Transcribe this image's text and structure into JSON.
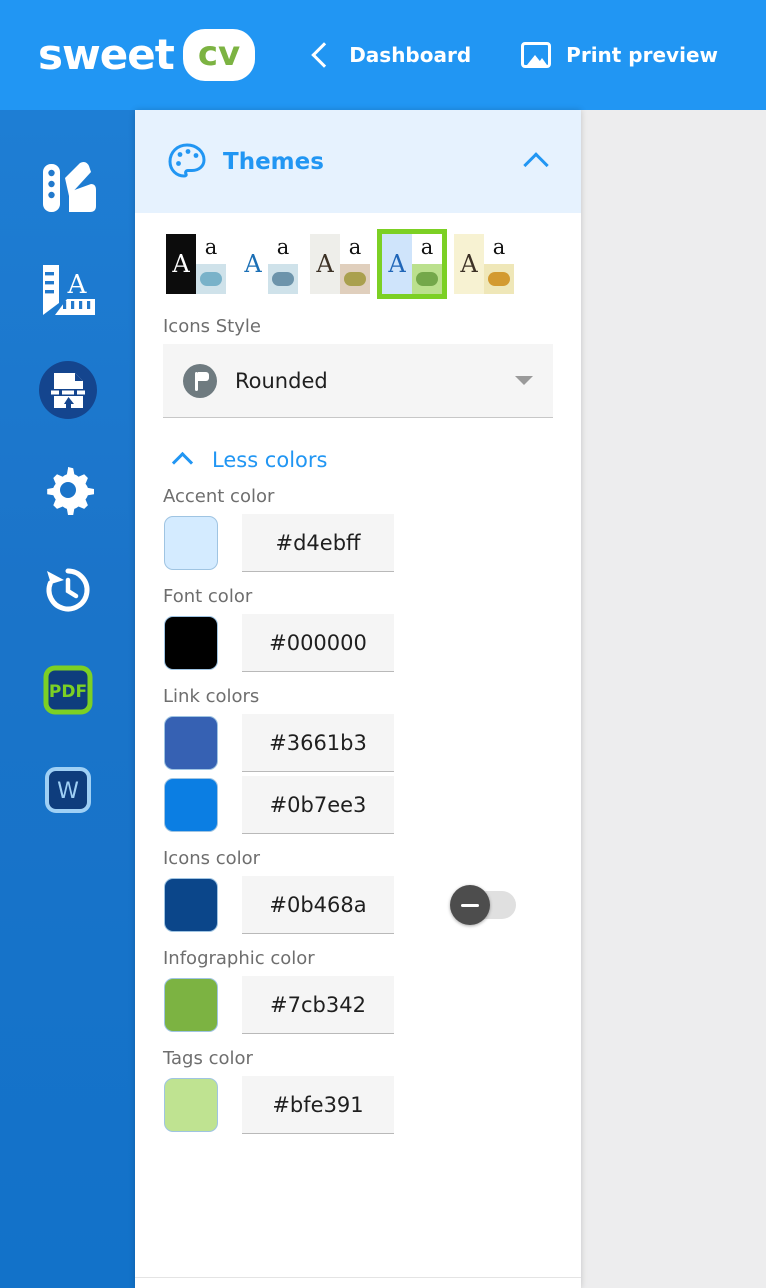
{
  "header": {
    "logo_word": "sweet",
    "logo_badge": "cv",
    "back_label": "Dashboard",
    "print_label": "Print preview",
    "bar_color": "#2196f3",
    "badge_text_color": "#7cb342"
  },
  "sidebar": {
    "items": [
      {
        "name": "themes-palette-icon",
        "label": "Themes"
      },
      {
        "name": "typography-icon",
        "label": "Typography"
      },
      {
        "name": "import-export-icon",
        "label": "Import / Export"
      },
      {
        "name": "settings-gear-icon",
        "label": "Settings"
      },
      {
        "name": "history-icon",
        "label": "History"
      },
      {
        "name": "pdf-icon",
        "label": "PDF"
      },
      {
        "name": "word-icon",
        "label": "W"
      }
    ]
  },
  "panel": {
    "title": "Themes",
    "collapse_icon": "chevron-up-icon",
    "themes": [
      {
        "name": "theme-dark",
        "selected": false,
        "letter_a_bg": "#0c0c0c",
        "letter_a_color": "#ffffff",
        "small_a_bg": "#ffffff",
        "small_a_color": "#111111",
        "dot_bg": "#cfe2ea",
        "dot_color": "#79b2c9"
      },
      {
        "name": "theme-white-blue",
        "selected": false,
        "letter_a_bg": "#ffffff",
        "letter_a_color": "#1b6fb5",
        "small_a_bg": "#ffffff",
        "small_a_color": "#111111",
        "dot_bg": "#cfe2ea",
        "dot_color": "#6d94ab"
      },
      {
        "name": "theme-beige",
        "selected": false,
        "letter_a_bg": "#eeeeea",
        "letter_a_color": "#3d3226",
        "small_a_bg": "#ffffff",
        "small_a_color": "#111111",
        "dot_bg": "#e0cfbd",
        "dot_color": "#aaa04e"
      },
      {
        "name": "theme-blue-green",
        "selected": true,
        "letter_a_bg": "#cfe4fb",
        "letter_a_color": "#2066b8",
        "small_a_bg": "#ffffff",
        "small_a_color": "#111111",
        "dot_bg": "#bbe08d",
        "dot_color": "#74a84a"
      },
      {
        "name": "theme-cream",
        "selected": false,
        "letter_a_bg": "#f7f2d2",
        "letter_a_color": "#3d3226",
        "small_a_bg": "#ffffff",
        "small_a_color": "#111111",
        "dot_bg": "#efe7b8",
        "dot_color": "#d39a30"
      }
    ],
    "selection_outline_color": "#7cd024",
    "icons_style": {
      "label": "Icons Style",
      "value": "Rounded",
      "icon": "flag-badge-icon",
      "caret": "caret-down-icon"
    },
    "less_colors": {
      "label": "Less colors",
      "icon": "chevron-up-icon"
    },
    "colors": [
      {
        "label": "Accent color",
        "value": "#d4ebff",
        "swatch": "#d4ebff",
        "has_toggle": false
      },
      {
        "label": "Font color",
        "value": "#000000",
        "swatch": "#000000",
        "has_toggle": false
      },
      {
        "label": "Link colors",
        "value": "#3661b3",
        "swatch": "#3661b3",
        "has_toggle": false
      },
      {
        "label": "",
        "value": "#0b7ee3",
        "swatch": "#0b7ee3",
        "has_toggle": false
      },
      {
        "label": "Icons color",
        "value": "#0b468a",
        "swatch": "#0b468a",
        "has_toggle": true
      },
      {
        "label": "Infographic color",
        "value": "#7cb342",
        "swatch": "#7cb342",
        "has_toggle": false
      },
      {
        "label": "Tags color",
        "value": "#bfe391",
        "swatch": "#bfe391",
        "has_toggle": false
      }
    ]
  }
}
